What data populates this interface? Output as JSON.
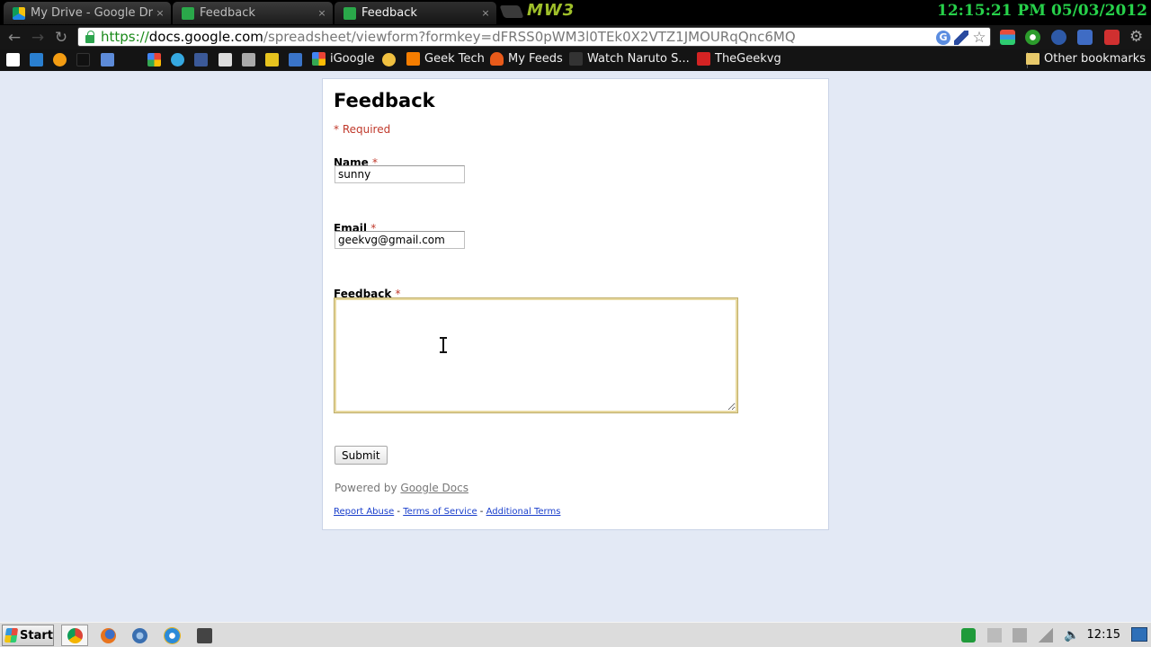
{
  "browser": {
    "tabs": [
      {
        "label": "My Drive - Google Driv",
        "icon": "google-drive-icon",
        "active": false
      },
      {
        "label": "Feedback",
        "icon": "google-forms-icon",
        "active": false
      },
      {
        "label": "Feedback",
        "icon": "google-forms-icon",
        "active": true
      }
    ],
    "close_glyph": "×",
    "mw3_logo": "MW3",
    "clock": "12:15:21 PM 05/03/2012",
    "url": {
      "scheme": "https://",
      "host": "docs.google.com",
      "path": "/spreadsheet/viewform?formkey=dFRSS0pWM3l0TEk0X2VTZ1JMOURqQnc6MQ"
    },
    "bookmarks": [
      {
        "label": "",
        "icon": "bookmark-icon-1"
      },
      {
        "label": "",
        "icon": "bookmark-icon-2"
      },
      {
        "label": "",
        "icon": "bookmark-icon-3"
      },
      {
        "label": "",
        "icon": "bookmark-icon-4"
      },
      {
        "label": "",
        "icon": "bookmark-icon-5"
      },
      {
        "label": "",
        "icon": "google-icon"
      },
      {
        "label": "",
        "icon": "twitter-icon"
      },
      {
        "label": "",
        "icon": "facebook-icon"
      },
      {
        "label": "",
        "icon": "bookmark-icon-9"
      },
      {
        "label": "",
        "icon": "bookmark-icon-10"
      },
      {
        "label": "",
        "icon": "bookmark-icon-11"
      },
      {
        "label": "",
        "icon": "bookmark-icon-12"
      },
      {
        "label": "iGoogle",
        "icon": "google-icon"
      },
      {
        "label": "",
        "icon": "bookmark-icon-14"
      },
      {
        "label": "Geek Tech",
        "icon": "blogger-icon"
      },
      {
        "label": "My Feeds",
        "icon": "feeds-icon"
      },
      {
        "label": "Watch Naruto S...",
        "icon": "naruto-icon"
      },
      {
        "label": "TheGeekvg",
        "icon": "youtube-icon"
      }
    ],
    "other_bookmarks": "Other bookmarks"
  },
  "form": {
    "title": "Feedback",
    "required_note": "* Required",
    "required_marker": "*",
    "questions": {
      "name": {
        "label": "Name",
        "value": "sunny"
      },
      "email": {
        "label": "Email",
        "value": "geekvg@gmail.com"
      },
      "feedback": {
        "label": "Feedback",
        "value": ""
      }
    },
    "submit_label": "Submit",
    "powered_by": "Powered by",
    "powered_by_link": "Google Docs",
    "footer": {
      "report_abuse": "Report Abuse",
      "terms": "Terms of Service",
      "additional_terms": "Additional Terms",
      "separator": "-"
    }
  },
  "taskbar": {
    "start_label": "Start",
    "apps": [
      "chrome-icon",
      "firefox-icon",
      "browser-icon",
      "ie-icon",
      "app-icon"
    ],
    "time": "12:15"
  },
  "colors": {
    "page_background": "#e3e9f5",
    "required_red": "#c0392b",
    "link_blue": "#1a3fcc",
    "clock_green": "#27d14a",
    "url_scheme_green": "#1a8a1a"
  }
}
